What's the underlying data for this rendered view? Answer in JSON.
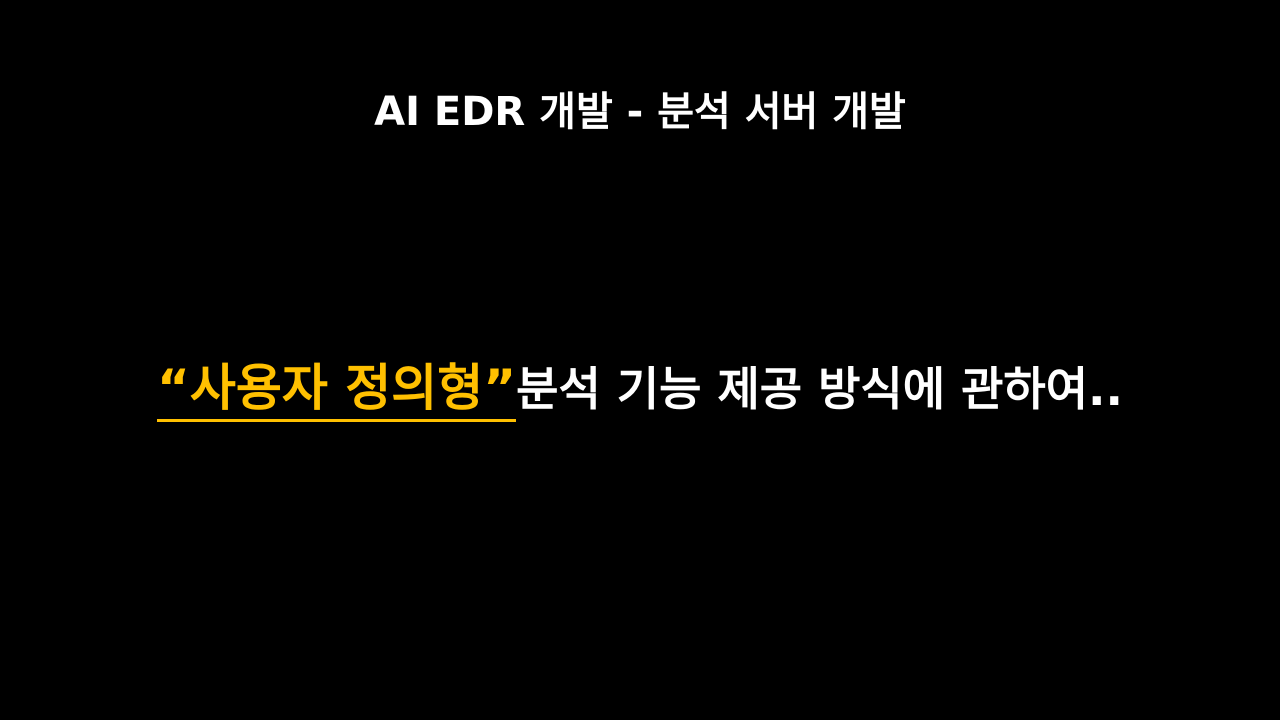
{
  "slide": {
    "title": "AI EDR 개발 - 분석 서버 개발",
    "highlight_text": "“사용자 정의형”",
    "body_text": "분석 기능 제공 방식에 관하여..",
    "accent_color": "#ffc000",
    "text_color": "#ffffff",
    "background_color": "#000000"
  }
}
